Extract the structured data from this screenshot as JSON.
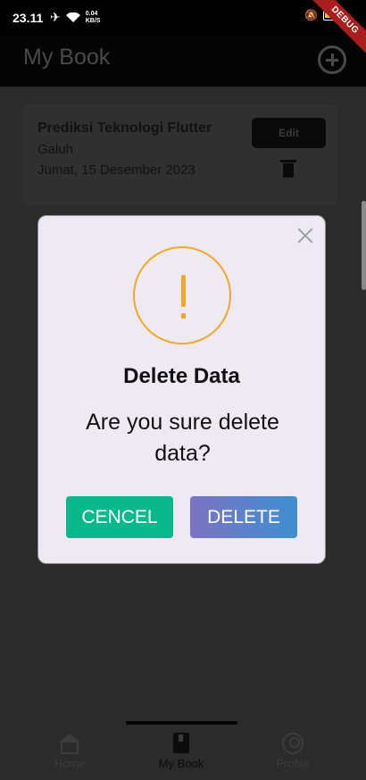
{
  "status": {
    "time": "23.11",
    "speed_top": "0.04",
    "speed_bottom": "KB/S"
  },
  "debug_banner": "DEBUG",
  "appbar": {
    "title": "My Book"
  },
  "books": [
    {
      "title": "Prediksi Teknologi Flutter",
      "author": "Galuh",
      "date": "Jumat, 15 Desember 2023",
      "edit_label": "Edit"
    }
  ],
  "dialog": {
    "title": "Delete Data",
    "message": "Are you sure delete data?",
    "cancel_label": "CENCEL",
    "delete_label": "DELETE"
  },
  "nav": {
    "home": "Home",
    "book": "My Book",
    "profile": "Profile"
  },
  "colors": {
    "warning": "#f5a623",
    "cancel": "#0ab98b",
    "delete_start": "#7c73c3",
    "delete_end": "#3f8fd2"
  }
}
